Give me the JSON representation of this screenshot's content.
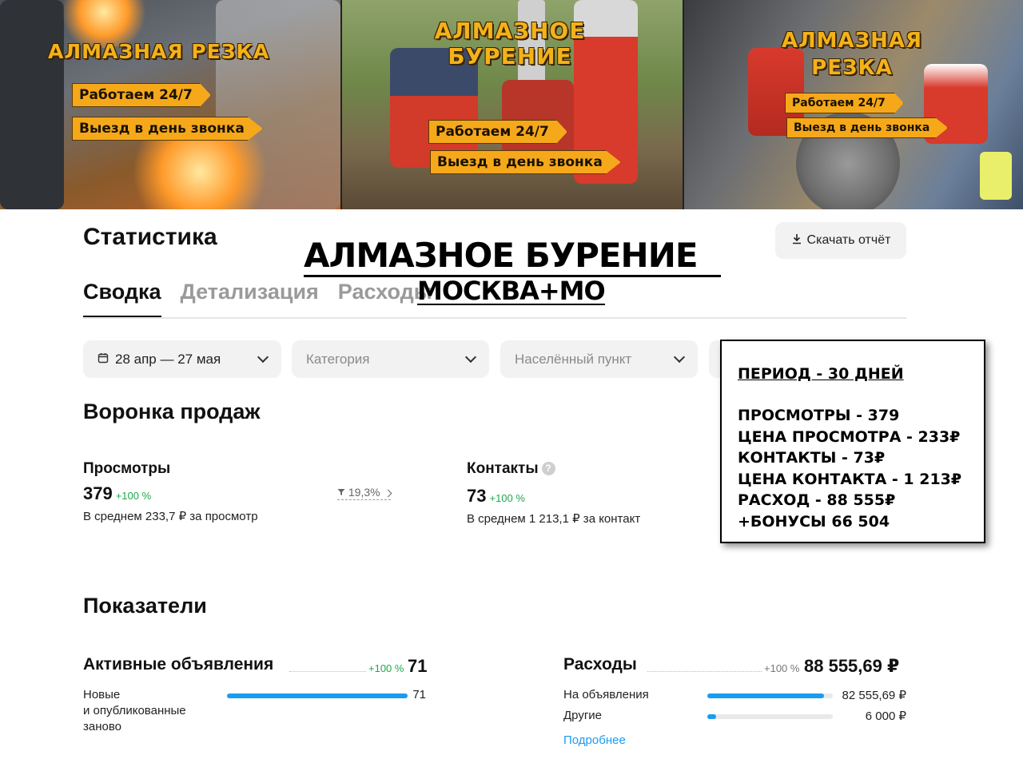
{
  "banner": {
    "panel1": {
      "title": "АЛМАЗНАЯ РЕЗКА",
      "tag1": "Работаем 24/7",
      "tag2": "Выезд в день звонка"
    },
    "panel2": {
      "title_line1": "АЛМАЗНОЕ",
      "title_line2": "БУРЕНИЕ",
      "tag1": "Работаем 24/7",
      "tag2": "Выезд в день звонка"
    },
    "panel3": {
      "title_line1": "АЛМАЗНАЯ",
      "title_line2": "РЕЗКА",
      "tag1": "Работаем 24/7",
      "tag2": "Выезд в день звонка"
    },
    "accent_color": "#f6a81b"
  },
  "header": {
    "title": "Статистика",
    "download_label": "Скачать отчёт",
    "overlay_title": "АЛМАЗНОЕ БУРЕНИЕ",
    "overlay_subtitle": "МОСКВА+МО"
  },
  "tabs": [
    {
      "label": "Сводка",
      "active": true
    },
    {
      "label": "Детализация",
      "active": false
    },
    {
      "label": "Расходы",
      "active": false
    }
  ],
  "filters": {
    "period": "28 апр — 27 мая",
    "category_placeholder": "Категория",
    "city_placeholder": "Населённый пункт"
  },
  "funnel": {
    "title": "Воронка продаж",
    "views": {
      "label": "Просмотры",
      "value": "379",
      "delta": "+100 %",
      "sub": "В среднем 233,7 ₽ за просмотр"
    },
    "conversion": "19,3%",
    "contacts": {
      "label": "Контакты",
      "value": "73",
      "delta": "+100 %",
      "sub": "В среднем 1 213,1 ₽ за контакт"
    }
  },
  "stats_box": {
    "period": "ПЕРИОД - 30 ДНЕЙ",
    "lines": [
      "ПРОСМОТРЫ - 379",
      "ЦЕНА ПРОСМОТРА - 233₽",
      "КОНТАКТЫ - 73₽",
      "ЦЕНА КОНТАКТА - 1 213₽",
      "РАСХОД - 88 555₽",
      "+БОНУСЫ 66 504"
    ]
  },
  "indicators": {
    "title": "Показатели",
    "active_ads": {
      "label": "Активные объявления",
      "delta": "+100 %",
      "total": "71",
      "rows": [
        {
          "label": "Новые\nи опубликованные\nзаново",
          "value": "71",
          "fraction": 1.0
        }
      ]
    },
    "expenses": {
      "label": "Расходы",
      "delta": "+100 %",
      "total": "88 555,69 ₽",
      "rows": [
        {
          "label": "На объявления",
          "value": "82 555,69 ₽",
          "fraction": 0.93
        },
        {
          "label": "Другие",
          "value": "6 000 ₽",
          "fraction": 0.07
        }
      ],
      "more_link": "Подробнее"
    },
    "positive_color": "#1fa84b",
    "bar_color": "#1a9cf0"
  }
}
